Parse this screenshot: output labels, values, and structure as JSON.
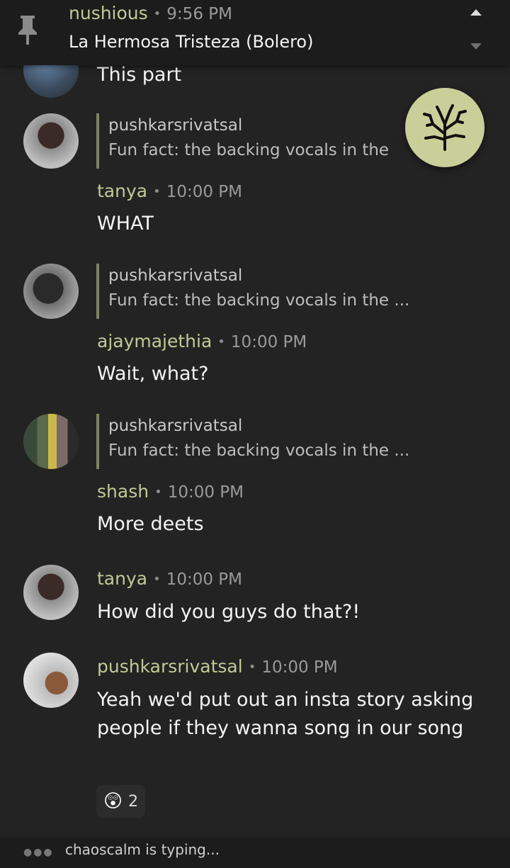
{
  "pinned": {
    "username": "nushious",
    "time": "9:56 PM",
    "song": "La Hermosa Tristeza (Bolero)",
    "partial_text": "This part"
  },
  "fab": {
    "icon": "coral-branch-icon"
  },
  "messages": [
    {
      "reply_user": "pushkarsrivatsal",
      "reply_text": "Fun fact: the backing vocals in the",
      "username": "tanya",
      "time": "10:00 PM",
      "text": "WHAT"
    },
    {
      "reply_user": "pushkarsrivatsal",
      "reply_text": "Fun fact: the backing vocals in the ...",
      "username": "ajaymajethia",
      "time": "10:00 PM",
      "text": "Wait, what?"
    },
    {
      "reply_user": "pushkarsrivatsal",
      "reply_text": "Fun fact: the backing vocals in the ...",
      "username": "shash",
      "time": "10:00 PM",
      "text": "More deets"
    },
    {
      "username": "tanya",
      "time": "10:00 PM",
      "text": "How did you guys do that?!"
    },
    {
      "username": "pushkarsrivatsal",
      "time": "10:00 PM",
      "text": "Yeah we'd put out an insta story asking people if they wanna song in our song"
    }
  ],
  "reaction": {
    "emoji": "😲",
    "count": "2"
  },
  "typing": {
    "text": "chaoscalm is typing..."
  },
  "colors": {
    "accent": "#c9cf99",
    "username": "#c2c996",
    "background": "#232323"
  }
}
